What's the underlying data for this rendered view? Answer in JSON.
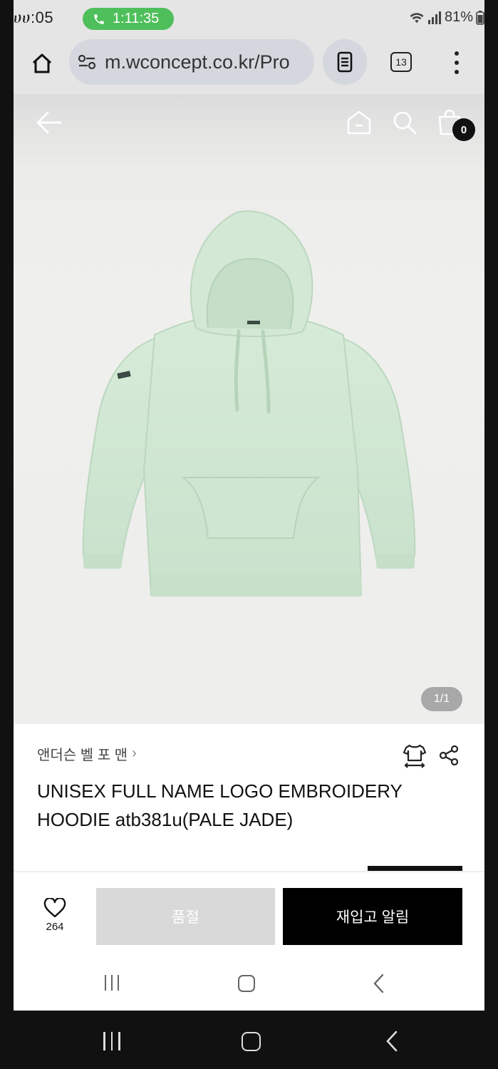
{
  "status_bar": {
    "time_left": "ሀሀ:05",
    "call_duration": "1:11:35",
    "right_indicators": "81%"
  },
  "browser": {
    "url": "m.wconcept.co.kr/Pro",
    "tab_count": "13"
  },
  "product_header": {
    "cart_count": "0"
  },
  "gallery": {
    "counter": "1/1"
  },
  "product": {
    "brand": "앤더슨 벨 포 맨",
    "brand_chevron": "›",
    "title": "UNISEX FULL NAME LOGO EMBROIDERY HOODIE atb381u(PALE JADE)",
    "color_name_hint": "PALE JADE"
  },
  "actions": {
    "like_count": "264",
    "soldout_label": "품절",
    "restock_label": "재입고 알림"
  },
  "colors": {
    "hoodie": "#cfe6d2",
    "soldout_bg": "#d9d9d9",
    "restock_bg": "#000000",
    "call_pill": "#4fbf5b"
  },
  "icons": [
    "home-icon",
    "site-settings-icon",
    "reader-mode-icon",
    "tab-switcher-icon",
    "more-menu-icon",
    "back-arrow-icon",
    "shop-home-icon",
    "search-icon",
    "shopping-bag-icon",
    "size-guide-icon",
    "share-icon",
    "heart-icon"
  ]
}
